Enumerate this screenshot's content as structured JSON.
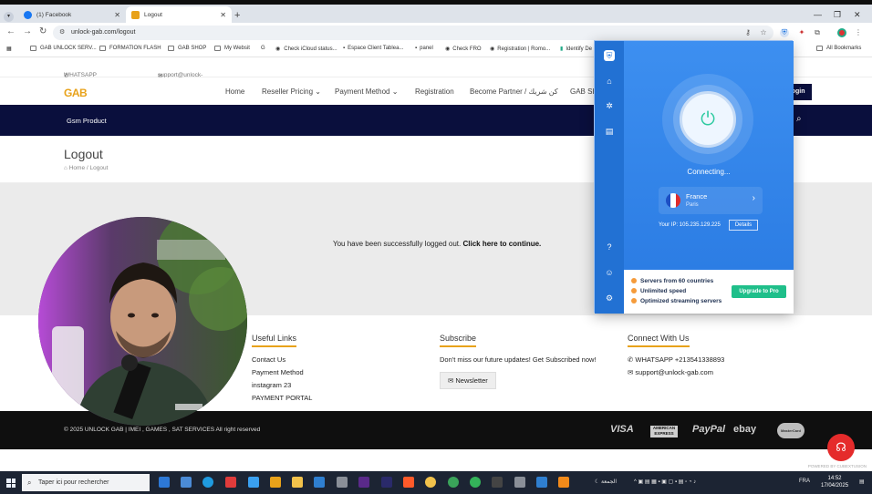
{
  "browser": {
    "tab_inactive_title": "(1) Facebook",
    "tab_active_title": "Logout",
    "url": "unlock-gab.com/logout",
    "all_bookmarks": "All Bookmarks",
    "bookmarks": [
      "GAB UNLOCK SERV...",
      "FORMATION FLASH",
      "GAB SHOP",
      "My Websit",
      "Check iCloud status...",
      "Espace Client Tablea...",
      "panel",
      "Check FRO",
      "Registration | Romo...",
      "Identify De"
    ]
  },
  "site": {
    "whatsapp_top": "WHATSAPP +213541338893",
    "email_top": "support@unlock-gab.com",
    "logo_text": "GAB",
    "nav": [
      "Home",
      "Reseller Pricing",
      "Payment Method",
      "Registration",
      "Become Partner / كن شريك",
      "GAB SH"
    ],
    "login_label": "Login",
    "gsm_product": "Gsm Product",
    "page_title": "Logout",
    "breadcrumb": "Home / Logout",
    "logout_message": "You have been successfully logged out.",
    "continue_link": "Click here to continue.",
    "footer": {
      "useful_links_title": "Useful Links",
      "useful_links": [
        "Contact Us",
        "Payment Method",
        "instagram 23",
        "PAYMENT PORTAL"
      ],
      "subscribe_title": "Subscribe",
      "subscribe_text": "Don't miss our future updates! Get Subscribed now!",
      "newsletter_label": "Newsletter",
      "connect_title": "Connect With Us",
      "connect_whatsapp": "WHATSAPP +213541338893",
      "connect_email": "support@unlock-gab.com"
    },
    "copyright": "© 2025 UNLOCK GAB | IMEI , GAMES , SAT SERVICES All right reserved",
    "payment_logos": [
      "VISA",
      "AMERICAN EXPRESS",
      "PayPal",
      "ebay",
      "MasterCard"
    ],
    "powered_by": "POWERED BY CUBEXTUSION"
  },
  "vpn": {
    "status": "Connecting...",
    "country": "France",
    "city": "Paris",
    "ip_label": "Your IP: 105.235.129.225",
    "details_label": "Details",
    "promo_items": [
      "Servers from 60 countries",
      "Unlimited speed",
      "Optimized streaming servers"
    ],
    "upgrade_label": "Upgrade to Pro",
    "accent": "#2a7ce0",
    "power_color": "#2ecaa0"
  },
  "taskbar": {
    "search_placeholder": "Taper ici pour rechercher",
    "lang": "FRA",
    "time": "14:52",
    "date": "17/04/2025",
    "weather": "الجمعة"
  }
}
